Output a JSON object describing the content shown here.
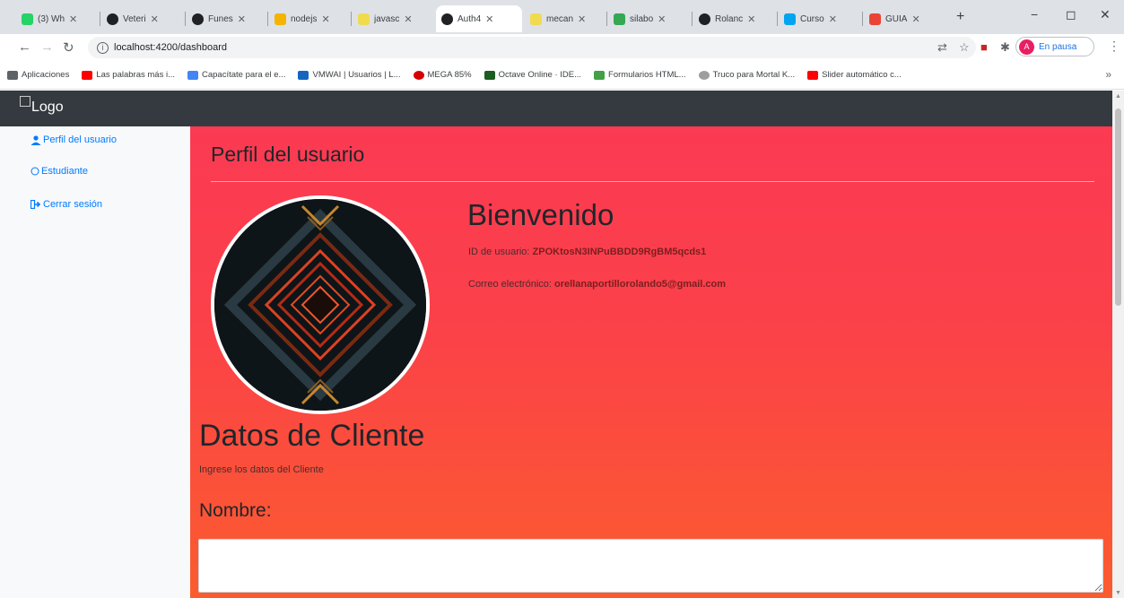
{
  "browser": {
    "tabs": [
      {
        "title": "(3) Wh",
        "color": "#25d366"
      },
      {
        "title": "Veteri",
        "color": "#202124"
      },
      {
        "title": "Funes",
        "color": "#202124"
      },
      {
        "title": "nodejs",
        "color": "#f4b400"
      },
      {
        "title": "javasc",
        "color": "#f0db4f"
      },
      {
        "title": "Auth4",
        "color": "#202124",
        "active": true
      },
      {
        "title": "mecan",
        "color": "#f0db4f"
      },
      {
        "title": "silabo",
        "color": "#34a853"
      },
      {
        "title": "Rolanc",
        "color": "#202124"
      },
      {
        "title": "Curso",
        "color": "#00a4ef"
      },
      {
        "title": "GUIA",
        "color": "#ea4335"
      }
    ],
    "new_tab": "+",
    "window_controls": {
      "minimize": "−",
      "maximize": "◻",
      "close": "✕"
    },
    "url": "localhost:4200/dashboard",
    "profile_label": "En pausa",
    "profile_initial": "A",
    "bookmarks": [
      {
        "label": "Aplicaciones",
        "color": "#5f6368"
      },
      {
        "label": "Las palabras más i...",
        "color": "#ff0000"
      },
      {
        "label": "Capacítate para el e...",
        "color": "#4285f4"
      },
      {
        "label": "VMWAI | Usuarios | L...",
        "color": "#1565c0"
      },
      {
        "label": "MEGA 85%",
        "color": "#d50000"
      },
      {
        "label": "Octave Online · IDE...",
        "color": "#1b5e20"
      },
      {
        "label": "Formularios HTML...",
        "color": "#43a047"
      },
      {
        "label": "Truco para Mortal K...",
        "color": "#9e9e9e"
      },
      {
        "label": "Slider automático c...",
        "color": "#ff0000"
      }
    ],
    "bookmarks_more": "»"
  },
  "navbar": {
    "brand": "Logo"
  },
  "sidebar": {
    "items": [
      {
        "label": "Perfil del usuario",
        "icon": "user-icon"
      },
      {
        "label": "Estudiante",
        "icon": "circle-icon"
      },
      {
        "label": "Cerrar sesión",
        "icon": "sign-out-icon"
      }
    ]
  },
  "profile": {
    "page_title": "Perfil del usuario",
    "welcome": "Bienvenido",
    "uid_label": "ID de usuario:",
    "uid_value": "ZPOKtosN3INPuBBDD9RgBM5qcds1",
    "email_label": "Correo electrónico:",
    "email_value": "orellanaportillorolando5@gmail.com"
  },
  "client_form": {
    "title": "Datos de Cliente",
    "subtitle": "Ingrese los datos del Cliente",
    "name_label": "Nombre:",
    "name_value": ""
  },
  "colors": {
    "navbar": "#343a40",
    "link": "#007bff",
    "content_gradient_top": "#fb3a53",
    "content_gradient_bottom": "#fb5c2e"
  }
}
